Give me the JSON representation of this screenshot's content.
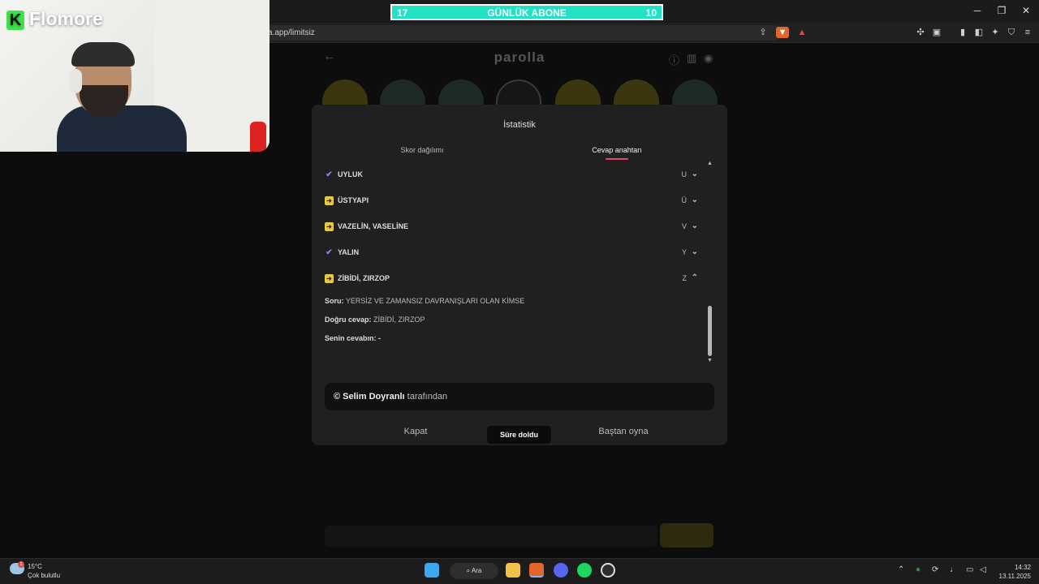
{
  "browser": {
    "url": "a.app/limitsiz",
    "window_controls": [
      "─",
      "❐",
      "✕"
    ]
  },
  "subscribe_banner": {
    "left_value": "17",
    "label": "GÜNLÜK ABONE",
    "right_value": "10"
  },
  "webcam": {
    "logo_text": "Flomore",
    "logo_letter": "K"
  },
  "page": {
    "title": "parolla"
  },
  "modal": {
    "title": "İstatistik",
    "tabs": [
      {
        "label": "Skor dağılımı",
        "active": false
      },
      {
        "label": "Cevap anahtarı",
        "active": true
      }
    ],
    "rows": [
      {
        "status": "correct",
        "word": "UYLUK",
        "letter": "U",
        "expanded": false
      },
      {
        "status": "skipped",
        "word": "ÜSTYAPI",
        "letter": "Ü",
        "expanded": false
      },
      {
        "status": "skipped",
        "word": "VAZELİN, VASELİNE",
        "letter": "V",
        "expanded": false
      },
      {
        "status": "correct",
        "word": "YALIN",
        "letter": "Y",
        "expanded": false
      },
      {
        "status": "skipped",
        "word": "ZİBİDİ, ZIRZOP",
        "letter": "Z",
        "expanded": true
      }
    ],
    "detail": {
      "question_label": "Soru:",
      "question": "YERSİZ VE ZAMANSIZ DAVRANIŞLARI OLAN KİMSE",
      "answer_label": "Doğru cevap:",
      "answer": "ZİBİDİ, ZIRZOP",
      "your_answer_label": "Senin cevabın:",
      "your_answer": "-"
    },
    "credit_author": "© Selim Doyranlı",
    "credit_suffix": "tarafından",
    "close_label": "Kapat",
    "time_pill": "Süre doldu",
    "restart_label": "Baştan oyna"
  },
  "taskbar": {
    "weather_badge": "1",
    "weather_temp": "15°C",
    "weather_desc": "Çok bulutlu",
    "search_label": "Ara",
    "time": "14:32",
    "date": "13.11.2025"
  },
  "colors": {
    "accent": "#e5486a",
    "correct": "#8a7ff0",
    "skipped": "#e8c94a",
    "banner": "#1fe3c2"
  }
}
